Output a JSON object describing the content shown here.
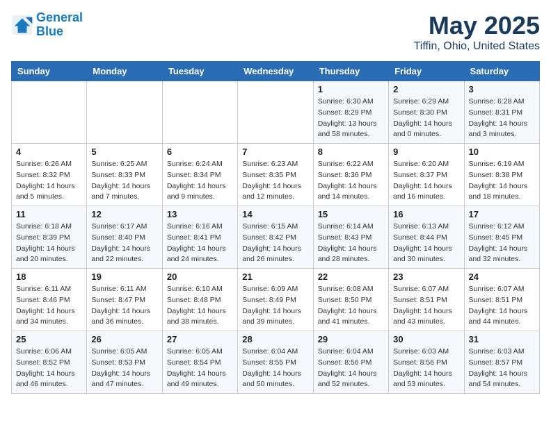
{
  "logo": {
    "line1": "General",
    "line2": "Blue"
  },
  "title": "May 2025",
  "location": "Tiffin, Ohio, United States",
  "days_of_week": [
    "Sunday",
    "Monday",
    "Tuesday",
    "Wednesday",
    "Thursday",
    "Friday",
    "Saturday"
  ],
  "weeks": [
    [
      {
        "day": "",
        "info": ""
      },
      {
        "day": "",
        "info": ""
      },
      {
        "day": "",
        "info": ""
      },
      {
        "day": "",
        "info": ""
      },
      {
        "day": "1",
        "info": "Sunrise: 6:30 AM\nSunset: 8:29 PM\nDaylight: 13 hours\nand 58 minutes."
      },
      {
        "day": "2",
        "info": "Sunrise: 6:29 AM\nSunset: 8:30 PM\nDaylight: 14 hours\nand 0 minutes."
      },
      {
        "day": "3",
        "info": "Sunrise: 6:28 AM\nSunset: 8:31 PM\nDaylight: 14 hours\nand 3 minutes."
      }
    ],
    [
      {
        "day": "4",
        "info": "Sunrise: 6:26 AM\nSunset: 8:32 PM\nDaylight: 14 hours\nand 5 minutes."
      },
      {
        "day": "5",
        "info": "Sunrise: 6:25 AM\nSunset: 8:33 PM\nDaylight: 14 hours\nand 7 minutes."
      },
      {
        "day": "6",
        "info": "Sunrise: 6:24 AM\nSunset: 8:34 PM\nDaylight: 14 hours\nand 9 minutes."
      },
      {
        "day": "7",
        "info": "Sunrise: 6:23 AM\nSunset: 8:35 PM\nDaylight: 14 hours\nand 12 minutes."
      },
      {
        "day": "8",
        "info": "Sunrise: 6:22 AM\nSunset: 8:36 PM\nDaylight: 14 hours\nand 14 minutes."
      },
      {
        "day": "9",
        "info": "Sunrise: 6:20 AM\nSunset: 8:37 PM\nDaylight: 14 hours\nand 16 minutes."
      },
      {
        "day": "10",
        "info": "Sunrise: 6:19 AM\nSunset: 8:38 PM\nDaylight: 14 hours\nand 18 minutes."
      }
    ],
    [
      {
        "day": "11",
        "info": "Sunrise: 6:18 AM\nSunset: 8:39 PM\nDaylight: 14 hours\nand 20 minutes."
      },
      {
        "day": "12",
        "info": "Sunrise: 6:17 AM\nSunset: 8:40 PM\nDaylight: 14 hours\nand 22 minutes."
      },
      {
        "day": "13",
        "info": "Sunrise: 6:16 AM\nSunset: 8:41 PM\nDaylight: 14 hours\nand 24 minutes."
      },
      {
        "day": "14",
        "info": "Sunrise: 6:15 AM\nSunset: 8:42 PM\nDaylight: 14 hours\nand 26 minutes."
      },
      {
        "day": "15",
        "info": "Sunrise: 6:14 AM\nSunset: 8:43 PM\nDaylight: 14 hours\nand 28 minutes."
      },
      {
        "day": "16",
        "info": "Sunrise: 6:13 AM\nSunset: 8:44 PM\nDaylight: 14 hours\nand 30 minutes."
      },
      {
        "day": "17",
        "info": "Sunrise: 6:12 AM\nSunset: 8:45 PM\nDaylight: 14 hours\nand 32 minutes."
      }
    ],
    [
      {
        "day": "18",
        "info": "Sunrise: 6:11 AM\nSunset: 8:46 PM\nDaylight: 14 hours\nand 34 minutes."
      },
      {
        "day": "19",
        "info": "Sunrise: 6:11 AM\nSunset: 8:47 PM\nDaylight: 14 hours\nand 36 minutes."
      },
      {
        "day": "20",
        "info": "Sunrise: 6:10 AM\nSunset: 8:48 PM\nDaylight: 14 hours\nand 38 minutes."
      },
      {
        "day": "21",
        "info": "Sunrise: 6:09 AM\nSunset: 8:49 PM\nDaylight: 14 hours\nand 39 minutes."
      },
      {
        "day": "22",
        "info": "Sunrise: 6:08 AM\nSunset: 8:50 PM\nDaylight: 14 hours\nand 41 minutes."
      },
      {
        "day": "23",
        "info": "Sunrise: 6:07 AM\nSunset: 8:51 PM\nDaylight: 14 hours\nand 43 minutes."
      },
      {
        "day": "24",
        "info": "Sunrise: 6:07 AM\nSunset: 8:51 PM\nDaylight: 14 hours\nand 44 minutes."
      }
    ],
    [
      {
        "day": "25",
        "info": "Sunrise: 6:06 AM\nSunset: 8:52 PM\nDaylight: 14 hours\nand 46 minutes."
      },
      {
        "day": "26",
        "info": "Sunrise: 6:05 AM\nSunset: 8:53 PM\nDaylight: 14 hours\nand 47 minutes."
      },
      {
        "day": "27",
        "info": "Sunrise: 6:05 AM\nSunset: 8:54 PM\nDaylight: 14 hours\nand 49 minutes."
      },
      {
        "day": "28",
        "info": "Sunrise: 6:04 AM\nSunset: 8:55 PM\nDaylight: 14 hours\nand 50 minutes."
      },
      {
        "day": "29",
        "info": "Sunrise: 6:04 AM\nSunset: 8:56 PM\nDaylight: 14 hours\nand 52 minutes."
      },
      {
        "day": "30",
        "info": "Sunrise: 6:03 AM\nSunset: 8:56 PM\nDaylight: 14 hours\nand 53 minutes."
      },
      {
        "day": "31",
        "info": "Sunrise: 6:03 AM\nSunset: 8:57 PM\nDaylight: 14 hours\nand 54 minutes."
      }
    ]
  ]
}
